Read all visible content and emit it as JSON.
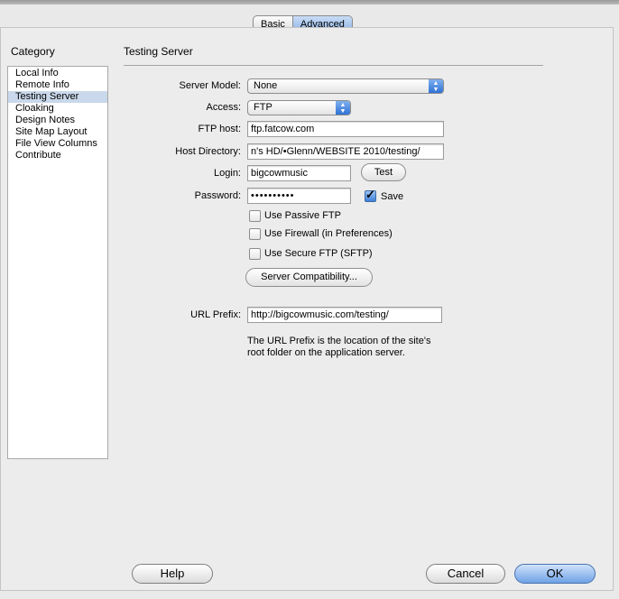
{
  "tabs": {
    "basic": "Basic",
    "advanced": "Advanced",
    "selected": "Advanced"
  },
  "category": {
    "heading": "Category",
    "items": [
      "Local Info",
      "Remote Info",
      "Testing Server",
      "Cloaking",
      "Design Notes",
      "Site Map Layout",
      "File View Columns",
      "Contribute"
    ],
    "selected": "Testing Server"
  },
  "section_title": "Testing Server",
  "form": {
    "server_model_label": "Server Model:",
    "server_model_value": "None",
    "access_label": "Access:",
    "access_value": "FTP",
    "ftp_host_label": "FTP host:",
    "ftp_host_value": "ftp.fatcow.com",
    "host_dir_label": "Host Directory:",
    "host_dir_value": "n's HD/•Glenn/WEBSITE 2010/testing/",
    "login_label": "Login:",
    "login_value": "bigcowmusic",
    "test_button": "Test",
    "password_label": "Password:",
    "password_value": "••••••••••",
    "save_label": "Save",
    "save_checked": true,
    "passive_ftp_label": "Use Passive FTP",
    "firewall_label": "Use Firewall (in Preferences)",
    "sftp_label": "Use Secure FTP (SFTP)",
    "compat_button": "Server Compatibility...",
    "url_prefix_label": "URL Prefix:",
    "url_prefix_value": "http://bigcowmusic.com/testing/",
    "help_line1": "The URL Prefix is the location of the site's",
    "help_line2": "root folder on the application server."
  },
  "buttons": {
    "help": "Help",
    "cancel": "Cancel",
    "ok": "OK"
  },
  "colors": {
    "accent": "#3e7fd9",
    "selection": "#c9d8ea"
  }
}
